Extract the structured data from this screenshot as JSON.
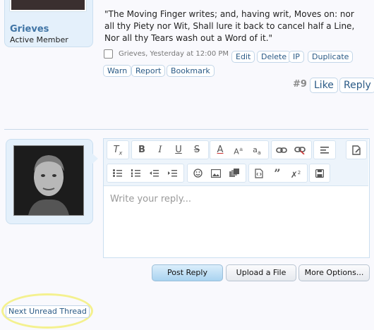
{
  "previous_post": {
    "member_name": "Grieves",
    "member_title": "Active Member",
    "message": "\"The Moving Finger writes; and, having writ, Moves on: nor all thy Piety nor Wit, Shall lure it back to cancel half a Line, Nor all thy Tears wash out a Word of it.\"",
    "meta": "Grieves, Yesterday at 12:00 PM",
    "actions": [
      "Edit",
      "Delete",
      "IP",
      "Duplicate"
    ],
    "actions_row2": [
      "Warn",
      "Report",
      "Bookmark"
    ],
    "post_number": "#9",
    "like_label": "Like",
    "reply_label": "Reply"
  },
  "editor": {
    "placeholder": "Write your reply...",
    "toolbar_icons": {
      "row1": [
        "clear-format-icon",
        "bold-icon",
        "italic-icon",
        "underline-icon",
        "strikethrough-icon",
        "text-color-icon",
        "font-size-icon",
        "font-family-icon",
        "link-icon",
        "unlink-icon",
        "align-icon",
        "draft-icon"
      ],
      "row2": [
        "bullet-list-icon",
        "numbered-list-icon",
        "outdent-icon",
        "indent-icon",
        "smilie-icon",
        "image-icon",
        "media-icon",
        "code-icon",
        "quote-icon",
        "remove-format-icon",
        "save-icon"
      ]
    }
  },
  "buttons": {
    "post_reply": "Post Reply",
    "upload_file": "Upload a File",
    "more_options": "More Options..."
  },
  "footer": {
    "next_unread": "Next Unread Thread"
  }
}
